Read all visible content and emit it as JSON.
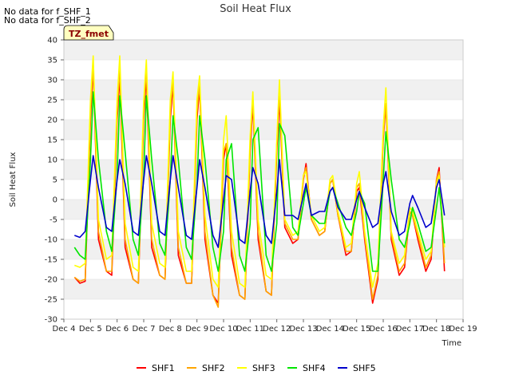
{
  "notes": [
    "No data for f_SHF_1",
    "No data for f_SHF_2"
  ],
  "badge": "TZ_fmet",
  "chart_data": {
    "type": "line",
    "title": "Soil Heat Flux",
    "xlabel": "Time",
    "ylabel": "Soil Heat Flux",
    "x_ticks": [
      "Dec 4",
      "Dec 5",
      "Dec 6",
      "Dec 7",
      "Dec 8",
      "Dec 9",
      "Dec 10",
      "Dec 11",
      "Dec 12",
      "Dec 13",
      "Dec 14",
      "Dec 15",
      "Dec 16",
      "Dec 17",
      "Dec 18",
      "Dec 19"
    ],
    "xlim": [
      4,
      19
    ],
    "ylim": [
      -30,
      40
    ],
    "y_ticks": [
      -30,
      -25,
      -20,
      -15,
      -10,
      -5,
      0,
      5,
      10,
      15,
      20,
      25,
      30,
      35,
      40
    ],
    "grid": true,
    "legend_position": "bottom",
    "x": [
      4.4,
      4.6,
      4.8,
      5.0,
      5.1,
      5.3,
      5.6,
      5.8,
      6.0,
      6.1,
      6.3,
      6.6,
      6.8,
      7.0,
      7.1,
      7.3,
      7.6,
      7.8,
      8.0,
      8.1,
      8.3,
      8.6,
      8.8,
      9.0,
      9.1,
      9.3,
      9.6,
      9.8,
      10.0,
      10.1,
      10.3,
      10.6,
      10.8,
      11.0,
      11.1,
      11.3,
      11.6,
      11.8,
      12.0,
      12.1,
      12.3,
      12.6,
      12.8,
      13.0,
      13.1,
      13.3,
      13.6,
      13.8,
      14.0,
      14.1,
      14.3,
      14.6,
      14.8,
      15.0,
      15.1,
      15.3,
      15.6,
      15.8,
      16.0,
      16.1,
      16.3,
      16.6,
      16.8,
      17.0,
      17.1,
      17.3,
      17.6,
      17.8,
      18.0,
      18.1,
      18.3
    ],
    "series": [
      {
        "name": "SHF1",
        "color": "#ff0000",
        "values": [
          -19.5,
          -21,
          -20.5,
          20,
          33,
          -10,
          -18,
          -19,
          20,
          31,
          -12,
          -20,
          -21,
          20,
          31,
          -12,
          -19,
          -20,
          20,
          29,
          -14,
          -21,
          -21,
          20,
          28,
          -10,
          -24,
          -26,
          10,
          14,
          -14,
          -24,
          -25,
          12,
          24,
          -10,
          -23,
          -24,
          12,
          25,
          -7,
          -11,
          -10,
          5,
          9,
          -5,
          -9,
          -8,
          4,
          5,
          -4,
          -14,
          -13,
          2,
          3,
          -10,
          -26,
          -20,
          15,
          24,
          -10,
          -19,
          -17,
          -3,
          -4,
          -10,
          -18,
          -15,
          5,
          8,
          -18
        ]
      },
      {
        "name": "SHF2",
        "color": "#ffa500",
        "values": [
          -19.5,
          -20.5,
          -20,
          22,
          34,
          -8,
          -18,
          -18,
          22,
          33,
          -10,
          -20,
          -21,
          22,
          33,
          -10,
          -19,
          -20,
          22,
          30,
          -12,
          -21,
          -21,
          22,
          29,
          -8,
          -24,
          -27,
          12,
          14,
          -12,
          -24,
          -25,
          14,
          25,
          -8,
          -23,
          -24,
          14,
          27,
          -6,
          -10,
          -10,
          6,
          8,
          -5,
          -9,
          -8,
          4,
          5,
          -4,
          -13,
          -13,
          3,
          4,
          -9,
          -25,
          -19,
          16,
          24,
          -9,
          -18,
          -16,
          -3,
          -4,
          -9,
          -17,
          -14,
          5,
          7,
          -16
        ]
      },
      {
        "name": "SHF3",
        "color": "#ffff00",
        "values": [
          -16.5,
          -17,
          -16,
          25,
          36,
          -5,
          -15,
          -14,
          25,
          36,
          -6,
          -17,
          -18,
          25,
          35,
          -6,
          -16,
          -17,
          25,
          32,
          -8,
          -18,
          -18,
          25,
          31,
          -4,
          -20,
          -22,
          15,
          21,
          -8,
          -21,
          -22,
          16,
          27,
          -5,
          -19,
          -20,
          15,
          30,
          -5,
          -9,
          -8,
          6,
          7,
          -4,
          -8,
          -7,
          5,
          6,
          -3,
          -12,
          -11,
          4,
          7,
          -8,
          -22,
          -16,
          18,
          28,
          -8,
          -16,
          -14,
          -2,
          -3,
          -8,
          -15,
          -13,
          4,
          6,
          -12
        ]
      },
      {
        "name": "SHF4",
        "color": "#00e600",
        "values": [
          -12,
          -14,
          -15,
          10,
          27,
          10,
          -8,
          -13,
          6,
          26,
          12,
          -10,
          -14,
          6,
          26,
          10,
          -11,
          -14,
          5,
          21,
          10,
          -12,
          -15,
          4,
          21,
          10,
          -12,
          -18,
          -8,
          10,
          14,
          -14,
          -18,
          -6,
          15,
          18,
          -14,
          -18,
          -6,
          19,
          16,
          -7,
          -9,
          -1,
          3,
          -4,
          -6,
          -6,
          2,
          3,
          -1,
          -7,
          -9,
          -3,
          2,
          -1,
          -18,
          -18,
          5,
          17,
          5,
          -10,
          -12,
          -6,
          -2,
          -6,
          -13,
          -12,
          -2,
          3,
          -11
        ]
      },
      {
        "name": "SHF5",
        "color": "#0000cc",
        "values": [
          -9,
          -9.5,
          -8,
          5,
          11,
          3,
          -7,
          -8,
          5,
          10,
          4,
          -8,
          -9,
          5,
          11,
          4,
          -8,
          -9,
          5,
          11,
          3,
          -9,
          -10,
          3,
          10,
          3,
          -9,
          -12,
          0,
          6,
          5,
          -10,
          -11,
          2,
          8,
          4,
          -9,
          -11,
          2,
          10,
          -4,
          -4,
          -5,
          1,
          4,
          -4,
          -3,
          -3,
          2,
          3,
          -2,
          -5,
          -5,
          0,
          2,
          -2,
          -7,
          -6,
          4,
          7,
          -3,
          -9,
          -8,
          -1,
          1,
          -2,
          -7,
          -6,
          3,
          5,
          -4
        ]
      }
    ]
  }
}
